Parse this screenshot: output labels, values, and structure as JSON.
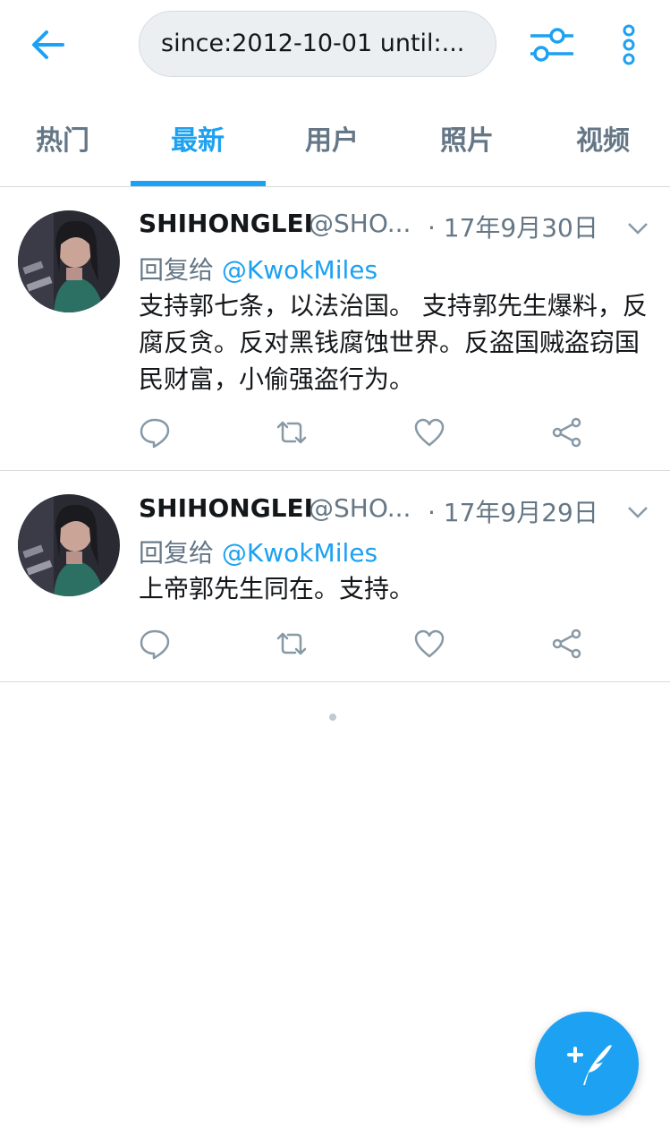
{
  "search": {
    "query": "since:2012-10-01 until:..."
  },
  "tabs": [
    {
      "label": "热门"
    },
    {
      "label": "最新"
    },
    {
      "label": "用户"
    },
    {
      "label": "照片"
    },
    {
      "label": "视频"
    }
  ],
  "active_tab": "最新",
  "tweets": [
    {
      "name": "SHIHONGLEI",
      "handle": "@SHO...",
      "date": "· 17年9月30日",
      "reply_prefix": "回复给",
      "reply_mention": "@KwokMiles",
      "text": "支持郭七条，以法治国。 支持郭先生爆料，反腐反贪。反对黑钱腐蚀世界。反盗国贼盗窃国民财富，小偷强盗行为。"
    },
    {
      "name": "SHIHONGLEI",
      "handle": "@SHO...",
      "date": "· 17年9月29日",
      "reply_prefix": "回复给",
      "reply_mention": "@KwokMiles",
      "text": "上帝郭先生同在。支持。"
    }
  ],
  "colors": {
    "accent": "#1da1f2",
    "secondary_text": "#657786",
    "divider": "#d7dbdf"
  },
  "icons": [
    "back-arrow-icon",
    "filter-sliders-icon",
    "more-vertical-icon",
    "chevron-down-icon",
    "reply-icon",
    "retweet-icon",
    "like-heart-icon",
    "share-icon",
    "compose-tweet-icon"
  ]
}
